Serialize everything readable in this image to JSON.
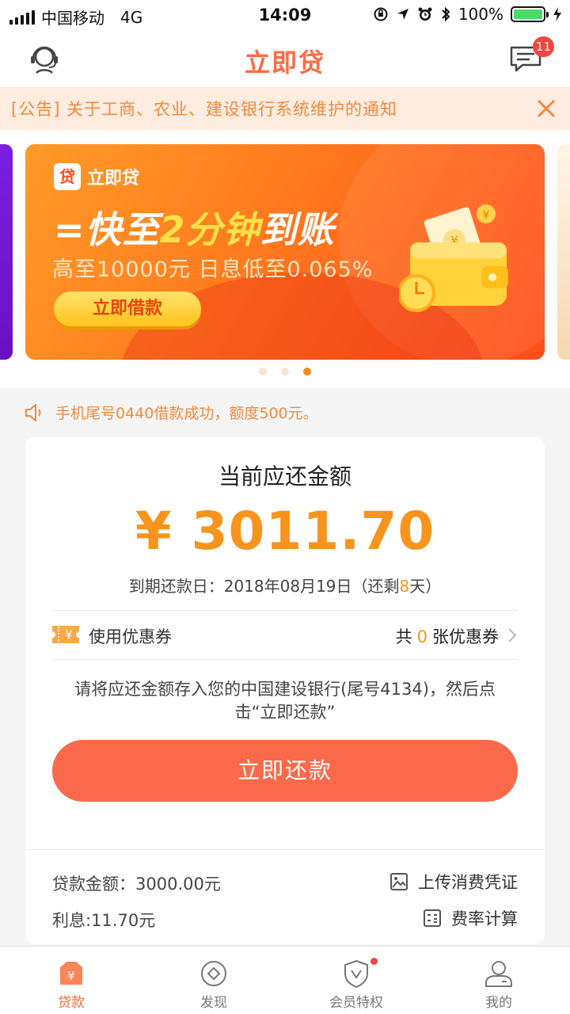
{
  "status_bar": {
    "carrier": "中国移动",
    "network": "4G",
    "time": "14:09",
    "battery": "100%"
  },
  "nav": {
    "title": "立即贷",
    "message_count": "11"
  },
  "notice": {
    "text": "[公告] 关于工商、农业、建设银行系统维护的通知"
  },
  "banner": {
    "logo_mark": "贷",
    "logo_text": "立即贷",
    "headline_pre": "=快至",
    "headline_highlight": "2分钟",
    "headline_post": "到账",
    "subline": "高至10000元 日息低至0.065%",
    "button": "立即借款",
    "active_dot_index": 2
  },
  "broadcast": {
    "text": "手机尾号0440借款成功，额度500元。"
  },
  "repayment": {
    "title": "当前应还金额",
    "amount": "¥ 3011.70",
    "due_prefix": "到期还款日：2018年08月19日（还剩",
    "days_left": "8",
    "due_suffix": "天）",
    "coupon_label": "使用优惠券",
    "coupon_icon_glyph": "¥",
    "coupon_prefix": "共",
    "coupon_num": "0",
    "coupon_suffix": "张优惠券",
    "instruction": "请将应还金额存入您的中国建设银行(尾号4134)，然后点击“立即还款”",
    "button": "立即还款",
    "loan_amount": "贷款金额：3000.00元",
    "interest": "利息:11.70元",
    "upload_label": "上传消费凭证",
    "rate_label": "费率计算"
  },
  "tabs": [
    {
      "label": "贷款",
      "icon": "loan-icon"
    },
    {
      "label": "发现",
      "icon": "discover-icon"
    },
    {
      "label": "会员特权",
      "icon": "member-icon"
    },
    {
      "label": "我的",
      "icon": "profile-icon"
    }
  ],
  "colors": {
    "accent": "#fb6c45",
    "amount": "#f7941d",
    "button": "#fa6a4a",
    "notice_bg": "#fdecdf"
  }
}
